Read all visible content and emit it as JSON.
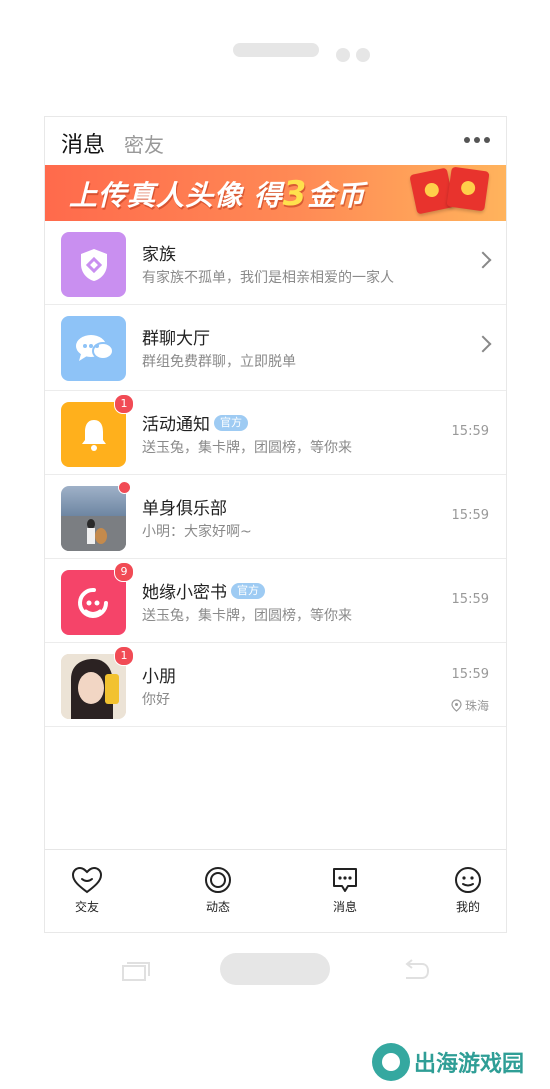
{
  "header": {
    "tab_messages": "消息",
    "tab_friends": "密友"
  },
  "banner": {
    "text_part1": "上传真人头像 得",
    "text_number": "3",
    "text_part2": "金币"
  },
  "list": [
    {
      "name": "家族",
      "desc": "有家族不孤单，我们是相亲相爱的一家人",
      "icon": "shield-icon",
      "color": "#c98ff0"
    },
    {
      "name": "群聊大厅",
      "desc": "群组免费群聊，立即脱单",
      "icon": "chat-bubbles-icon",
      "color": "#8ec3f7"
    },
    {
      "name": "活动通知",
      "tag": "官方",
      "desc": "送玉兔，集卡牌，团圆榜，等你来",
      "time": "15:59",
      "badge": "1",
      "icon": "bell-icon",
      "color": "#ffb01c"
    },
    {
      "name": "单身俱乐部",
      "desc": "小明：大家好啊~",
      "time": "15:59",
      "icon": "photo-avatar"
    },
    {
      "name": "她缘小密书",
      "tag": "官方",
      "desc": "送玉兔，集卡牌，团圆榜，等你来",
      "time": "15:59",
      "badge": "9",
      "icon": "headset-face-icon",
      "color": "#f54469"
    },
    {
      "name": "小朋",
      "desc": "你好",
      "time": "15:59",
      "badge": "1",
      "location": "珠海",
      "icon": "photo-avatar"
    }
  ],
  "tabbar": {
    "items": [
      {
        "label": "交友",
        "icon": "heart-face-icon"
      },
      {
        "label": "动态",
        "icon": "ring-icon"
      },
      {
        "label": "消息",
        "icon": "message-icon"
      },
      {
        "label": "我的",
        "icon": "smile-icon"
      }
    ]
  },
  "watermark": {
    "text": "出海游戏园"
  }
}
